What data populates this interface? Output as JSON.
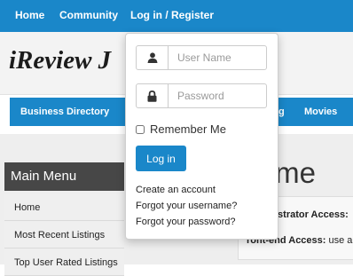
{
  "topnav": {
    "items": [
      {
        "label": "Home"
      },
      {
        "label": "Community"
      },
      {
        "label": "Log in / Register"
      }
    ]
  },
  "site": {
    "brand": "iReview J"
  },
  "mainnav": {
    "items": [
      {
        "label": "Business Directory"
      },
      {
        "label": "g"
      },
      {
        "label": "Movies"
      }
    ]
  },
  "sidebar": {
    "title": "Main Menu",
    "items": [
      {
        "label": "Home"
      },
      {
        "label": "Most Recent Listings"
      },
      {
        "label": "Top User Rated Listings"
      }
    ]
  },
  "main": {
    "heading": "lcome",
    "access": [
      {
        "label": "istrator Access:",
        "text": ""
      },
      {
        "label": "ront-end Access:",
        "text": "use a"
      }
    ]
  },
  "login_dropdown": {
    "username_placeholder": "User Name",
    "password_placeholder": "Password",
    "remember_label": "Remember Me",
    "login_button": "Log in",
    "links": [
      {
        "label": "Create an account"
      },
      {
        "label": "Forgot your username?"
      },
      {
        "label": "Forgot your password?"
      }
    ]
  },
  "colors": {
    "primary": "#1a87c9",
    "menu_header": "#474747"
  }
}
